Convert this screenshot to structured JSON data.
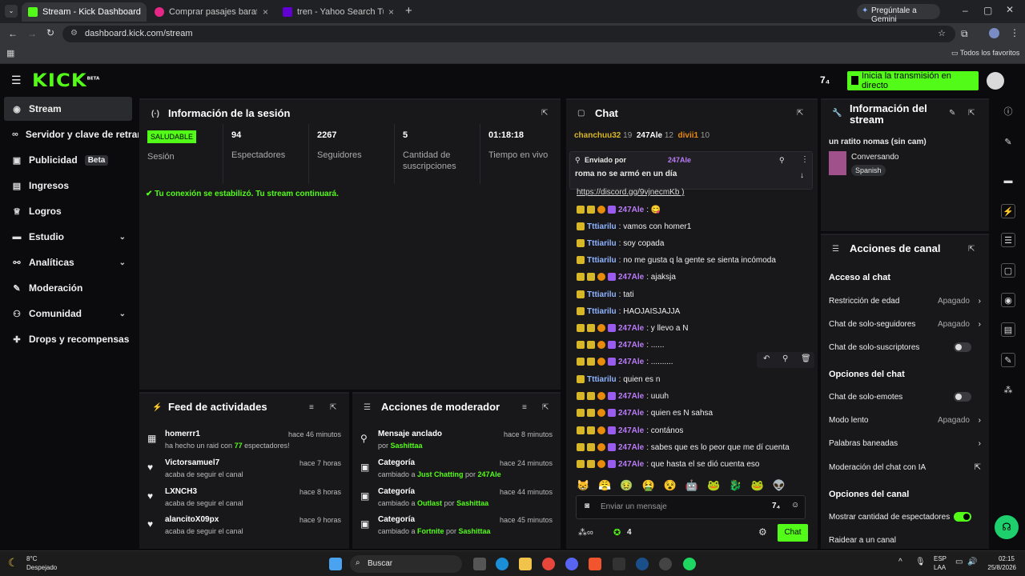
{
  "browser": {
    "tabs": [
      {
        "label": "Stream - Kick Dashboard",
        "active": true
      },
      {
        "label": "Comprar pasajes baratos Loma",
        "active": false
      },
      {
        "label": "tren - Yahoo Search Tus resulta",
        "active": false
      }
    ],
    "gemini": "Pregúntale a Gemini",
    "url": "dashboard.kick.com/stream",
    "bookmarks_all": "Todos los favoritos"
  },
  "header": {
    "logo": "KICK",
    "logo_badge": "BETA",
    "go_live": "Inicia la transmisión en directo"
  },
  "sidebar": {
    "items": [
      {
        "label": "Stream",
        "icon": "radio-icon"
      },
      {
        "label": "Servidor y clave de retransmisión",
        "icon": "link-icon"
      },
      {
        "label": "Publicidad",
        "icon": "ad-icon",
        "badge": "Beta"
      },
      {
        "label": "Ingresos",
        "icon": "chart-icon"
      },
      {
        "label": "Logros",
        "icon": "trophy-icon"
      },
      {
        "label": "Estudio",
        "icon": "studio-icon"
      },
      {
        "label": "Analíticas",
        "icon": "analytics-icon"
      },
      {
        "label": "Moderación",
        "icon": "wrench-icon"
      },
      {
        "label": "Comunidad",
        "icon": "community-icon"
      },
      {
        "label": "Drops y recompensas",
        "icon": "gift-icon"
      }
    ]
  },
  "session": {
    "title": "Información de la sesión",
    "status_badge": "SALUDABLE",
    "status_label": "Sesión",
    "stats": [
      {
        "value": "94",
        "label": "Espectadores"
      },
      {
        "value": "2267",
        "label": "Seguidores"
      },
      {
        "value": "5",
        "label": "Cantidad de suscripciones"
      },
      {
        "value": "01:18:18",
        "label": "Tiempo en vivo"
      }
    ],
    "connection_msg": "Tu conexión se estabilizó. Tu stream continuará."
  },
  "feed": {
    "title": "Feed de actividades",
    "items": [
      {
        "name": "homerrr1",
        "pre": "ha hecho un raid con ",
        "count": "77",
        "post": " espectadores!",
        "time": "hace 46 minutos"
      },
      {
        "name": "Victorsamuel7",
        "sub": "acaba de seguir el canal",
        "time": "hace 7 horas"
      },
      {
        "name": "LXNCH3",
        "sub": "acaba de seguir el canal",
        "time": "hace 8 horas"
      },
      {
        "name": "alancitoX09px",
        "sub": "acaba de seguir el canal",
        "time": "hace 9 horas"
      }
    ]
  },
  "modactions": {
    "title": "Acciones de moderador",
    "items": [
      {
        "title": "Mensaje anclado",
        "pre": "por ",
        "a": "Sashittaa",
        "mid": "",
        "b": "",
        "time": "hace 8 minutos"
      },
      {
        "title": "Categoría",
        "pre": "cambiado a ",
        "a": "Just Chatting",
        "mid": " por ",
        "b": "247Ale",
        "time": "hace 24 minutos"
      },
      {
        "title": "Categoría",
        "pre": "cambiado a ",
        "a": "Outlast",
        "mid": " por ",
        "b": "Sashittaa",
        "time": "hace 44 minutos"
      },
      {
        "title": "Categoría",
        "pre": "cambiado a ",
        "a": "Fortnite",
        "mid": " por ",
        "b": "Sashittaa",
        "time": "hace 45 minutos"
      }
    ]
  },
  "chat": {
    "title": "Chat",
    "leaderboard": [
      {
        "name": "chanchuu32",
        "score": "19"
      },
      {
        "name": "247Ale",
        "score": "12"
      },
      {
        "name": "divii1",
        "score": "10"
      }
    ],
    "pinned_by_label": "Enviado por",
    "pinned_user": "247Ale",
    "pinned_text": "roma no se armó en un día",
    "link_fragment": "https://discord.gg/9vjnecmKb )",
    "messages": [
      {
        "user": "247Ale",
        "text": ": 😋",
        "kind": "ale"
      },
      {
        "user": "Tttiarilu",
        "text": ": vamos con homer1",
        "kind": "tti"
      },
      {
        "user": "Tttiarilu",
        "text": ": soy copada",
        "kind": "tti"
      },
      {
        "user": "Tttiarilu",
        "text": ": no me gusta q la gente se sienta incómoda",
        "kind": "tti"
      },
      {
        "user": "247Ale",
        "text": ": ajaksja",
        "kind": "ale"
      },
      {
        "user": "Tttiarilu",
        "text": ": tati",
        "kind": "tti"
      },
      {
        "user": "Tttiarilu",
        "text": ": HAOJAISJAJJA",
        "kind": "tti"
      },
      {
        "user": "247Ale",
        "text": ": y llevo a N",
        "kind": "ale"
      },
      {
        "user": "247Ale",
        "text": ": ......",
        "kind": "ale"
      },
      {
        "user": "247Ale",
        "text": ": ..........",
        "kind": "ale"
      },
      {
        "user": "Tttiarilu",
        "text": ": quien es n",
        "kind": "tti"
      },
      {
        "user": "247Ale",
        "text": ": uuuh",
        "kind": "ale"
      },
      {
        "user": "247Ale",
        "text": ": quien es N sahsa",
        "kind": "ale"
      },
      {
        "user": "247Ale",
        "text": ": contános",
        "kind": "ale"
      },
      {
        "user": "247Ale",
        "text": ": sabes que es lo peor que me dí cuenta",
        "kind": "ale"
      },
      {
        "user": "247Ale",
        "text": ": que hasta el se dió cuenta eso",
        "kind": "ale"
      }
    ],
    "input_placeholder": "Enviar un mensaje",
    "points": "4",
    "send_label": "Chat"
  },
  "streaminfo": {
    "title": "Información del stream",
    "stream_title": "un ratito nomas (sin cam)",
    "category": "Conversando",
    "language": "Spanish"
  },
  "channel": {
    "title": "Acciones de canal",
    "s1": "Acceso al chat",
    "age": "Restricción de edad",
    "age_val": "Apagado",
    "followers": "Chat de solo-seguidores",
    "followers_val": "Apagado",
    "subs": "Chat de solo-suscriptores",
    "s2": "Opciones del chat",
    "emotes": "Chat de solo-emotes",
    "slow": "Modo lento",
    "slow_val": "Apagado",
    "banned": "Palabras baneadas",
    "aimod": "Moderación del chat con IA",
    "s3": "Opciones del canal",
    "viewers": "Mostrar cantidad de espectadores",
    "raid": "Raidear a un canal"
  },
  "taskbar": {
    "temp": "8°C",
    "weather": "Despejado",
    "search": "Buscar",
    "lang1": "ESP",
    "lang2": "LAA",
    "time": "02:15",
    "date": "25/8/2026"
  },
  "colors": {
    "accent": "#53fc18",
    "panel": "#18181b",
    "bg": "#0b0b0d"
  }
}
